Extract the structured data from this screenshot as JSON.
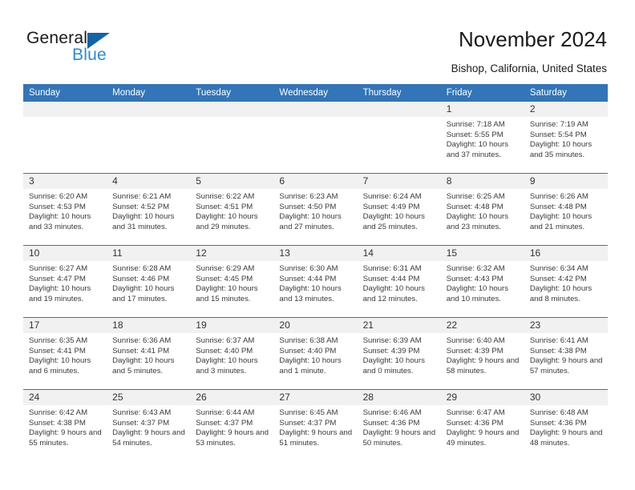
{
  "brand": {
    "word_general": "General",
    "word_blue": "Blue",
    "flag_icon": "blue-triangle-flag-icon",
    "accent_dark": "#1264a3",
    "accent_light": "#2a8bd4"
  },
  "header": {
    "title": "November 2024",
    "location": "Bishop, California, United States"
  },
  "theme": {
    "header_row_bg": "#3275b8",
    "daynum_bg": "#f1f1f1",
    "cell_bg": "#ffffff",
    "text": "#3a3a3a"
  },
  "weekday_headers": [
    "Sunday",
    "Monday",
    "Tuesday",
    "Wednesday",
    "Thursday",
    "Friday",
    "Saturday"
  ],
  "weeks": [
    [
      {
        "day": "",
        "empty": true,
        "sunrise": "",
        "sunset": "",
        "daylight": ""
      },
      {
        "day": "",
        "empty": true,
        "sunrise": "",
        "sunset": "",
        "daylight": ""
      },
      {
        "day": "",
        "empty": true,
        "sunrise": "",
        "sunset": "",
        "daylight": ""
      },
      {
        "day": "",
        "empty": true,
        "sunrise": "",
        "sunset": "",
        "daylight": ""
      },
      {
        "day": "",
        "empty": true,
        "sunrise": "",
        "sunset": "",
        "daylight": ""
      },
      {
        "day": "1",
        "empty": false,
        "sunrise": "Sunrise: 7:18 AM",
        "sunset": "Sunset: 5:55 PM",
        "daylight": "Daylight: 10 hours and 37 minutes."
      },
      {
        "day": "2",
        "empty": false,
        "sunrise": "Sunrise: 7:19 AM",
        "sunset": "Sunset: 5:54 PM",
        "daylight": "Daylight: 10 hours and 35 minutes."
      }
    ],
    [
      {
        "day": "3",
        "empty": false,
        "sunrise": "Sunrise: 6:20 AM",
        "sunset": "Sunset: 4:53 PM",
        "daylight": "Daylight: 10 hours and 33 minutes."
      },
      {
        "day": "4",
        "empty": false,
        "sunrise": "Sunrise: 6:21 AM",
        "sunset": "Sunset: 4:52 PM",
        "daylight": "Daylight: 10 hours and 31 minutes."
      },
      {
        "day": "5",
        "empty": false,
        "sunrise": "Sunrise: 6:22 AM",
        "sunset": "Sunset: 4:51 PM",
        "daylight": "Daylight: 10 hours and 29 minutes."
      },
      {
        "day": "6",
        "empty": false,
        "sunrise": "Sunrise: 6:23 AM",
        "sunset": "Sunset: 4:50 PM",
        "daylight": "Daylight: 10 hours and 27 minutes."
      },
      {
        "day": "7",
        "empty": false,
        "sunrise": "Sunrise: 6:24 AM",
        "sunset": "Sunset: 4:49 PM",
        "daylight": "Daylight: 10 hours and 25 minutes."
      },
      {
        "day": "8",
        "empty": false,
        "sunrise": "Sunrise: 6:25 AM",
        "sunset": "Sunset: 4:48 PM",
        "daylight": "Daylight: 10 hours and 23 minutes."
      },
      {
        "day": "9",
        "empty": false,
        "sunrise": "Sunrise: 6:26 AM",
        "sunset": "Sunset: 4:48 PM",
        "daylight": "Daylight: 10 hours and 21 minutes."
      }
    ],
    [
      {
        "day": "10",
        "empty": false,
        "sunrise": "Sunrise: 6:27 AM",
        "sunset": "Sunset: 4:47 PM",
        "daylight": "Daylight: 10 hours and 19 minutes."
      },
      {
        "day": "11",
        "empty": false,
        "sunrise": "Sunrise: 6:28 AM",
        "sunset": "Sunset: 4:46 PM",
        "daylight": "Daylight: 10 hours and 17 minutes."
      },
      {
        "day": "12",
        "empty": false,
        "sunrise": "Sunrise: 6:29 AM",
        "sunset": "Sunset: 4:45 PM",
        "daylight": "Daylight: 10 hours and 15 minutes."
      },
      {
        "day": "13",
        "empty": false,
        "sunrise": "Sunrise: 6:30 AM",
        "sunset": "Sunset: 4:44 PM",
        "daylight": "Daylight: 10 hours and 13 minutes."
      },
      {
        "day": "14",
        "empty": false,
        "sunrise": "Sunrise: 6:31 AM",
        "sunset": "Sunset: 4:44 PM",
        "daylight": "Daylight: 10 hours and 12 minutes."
      },
      {
        "day": "15",
        "empty": false,
        "sunrise": "Sunrise: 6:32 AM",
        "sunset": "Sunset: 4:43 PM",
        "daylight": "Daylight: 10 hours and 10 minutes."
      },
      {
        "day": "16",
        "empty": false,
        "sunrise": "Sunrise: 6:34 AM",
        "sunset": "Sunset: 4:42 PM",
        "daylight": "Daylight: 10 hours and 8 minutes."
      }
    ],
    [
      {
        "day": "17",
        "empty": false,
        "sunrise": "Sunrise: 6:35 AM",
        "sunset": "Sunset: 4:41 PM",
        "daylight": "Daylight: 10 hours and 6 minutes."
      },
      {
        "day": "18",
        "empty": false,
        "sunrise": "Sunrise: 6:36 AM",
        "sunset": "Sunset: 4:41 PM",
        "daylight": "Daylight: 10 hours and 5 minutes."
      },
      {
        "day": "19",
        "empty": false,
        "sunrise": "Sunrise: 6:37 AM",
        "sunset": "Sunset: 4:40 PM",
        "daylight": "Daylight: 10 hours and 3 minutes."
      },
      {
        "day": "20",
        "empty": false,
        "sunrise": "Sunrise: 6:38 AM",
        "sunset": "Sunset: 4:40 PM",
        "daylight": "Daylight: 10 hours and 1 minute."
      },
      {
        "day": "21",
        "empty": false,
        "sunrise": "Sunrise: 6:39 AM",
        "sunset": "Sunset: 4:39 PM",
        "daylight": "Daylight: 10 hours and 0 minutes."
      },
      {
        "day": "22",
        "empty": false,
        "sunrise": "Sunrise: 6:40 AM",
        "sunset": "Sunset: 4:39 PM",
        "daylight": "Daylight: 9 hours and 58 minutes."
      },
      {
        "day": "23",
        "empty": false,
        "sunrise": "Sunrise: 6:41 AM",
        "sunset": "Sunset: 4:38 PM",
        "daylight": "Daylight: 9 hours and 57 minutes."
      }
    ],
    [
      {
        "day": "24",
        "empty": false,
        "sunrise": "Sunrise: 6:42 AM",
        "sunset": "Sunset: 4:38 PM",
        "daylight": "Daylight: 9 hours and 55 minutes."
      },
      {
        "day": "25",
        "empty": false,
        "sunrise": "Sunrise: 6:43 AM",
        "sunset": "Sunset: 4:37 PM",
        "daylight": "Daylight: 9 hours and 54 minutes."
      },
      {
        "day": "26",
        "empty": false,
        "sunrise": "Sunrise: 6:44 AM",
        "sunset": "Sunset: 4:37 PM",
        "daylight": "Daylight: 9 hours and 53 minutes."
      },
      {
        "day": "27",
        "empty": false,
        "sunrise": "Sunrise: 6:45 AM",
        "sunset": "Sunset: 4:37 PM",
        "daylight": "Daylight: 9 hours and 51 minutes."
      },
      {
        "day": "28",
        "empty": false,
        "sunrise": "Sunrise: 6:46 AM",
        "sunset": "Sunset: 4:36 PM",
        "daylight": "Daylight: 9 hours and 50 minutes."
      },
      {
        "day": "29",
        "empty": false,
        "sunrise": "Sunrise: 6:47 AM",
        "sunset": "Sunset: 4:36 PM",
        "daylight": "Daylight: 9 hours and 49 minutes."
      },
      {
        "day": "30",
        "empty": false,
        "sunrise": "Sunrise: 6:48 AM",
        "sunset": "Sunset: 4:36 PM",
        "daylight": "Daylight: 9 hours and 48 minutes."
      }
    ]
  ]
}
